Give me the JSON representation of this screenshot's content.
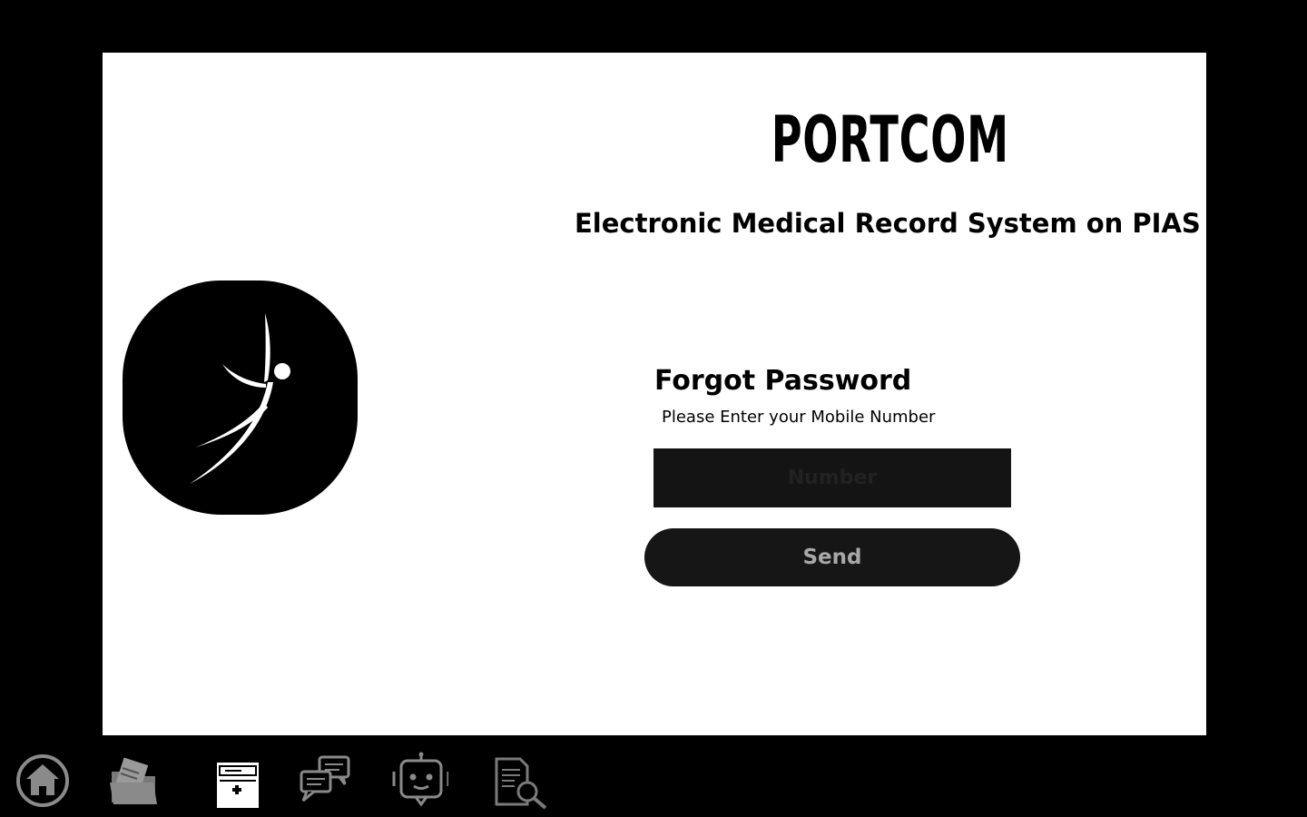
{
  "app": {
    "brand": "PORTCOM",
    "subtitle": "Electronic Medical Record System on PIAS"
  },
  "form": {
    "title": "Forgot Password",
    "hint": "Please Enter your Mobile Number",
    "number_placeholder": "Number",
    "number_value": "",
    "send_label": "Send"
  },
  "dock": {
    "items": [
      {
        "icon": "home-icon",
        "active": false
      },
      {
        "icon": "folder-icon",
        "active": false
      },
      {
        "icon": "medical-record-icon",
        "active": true
      },
      {
        "icon": "chat-icon",
        "active": false
      },
      {
        "icon": "robot-icon",
        "active": false
      },
      {
        "icon": "document-search-icon",
        "active": false
      }
    ]
  },
  "colors": {
    "background": "#000000",
    "panel": "#ffffff",
    "input_bg": "#141414",
    "button_bg": "#161616",
    "button_text": "#a8a8a8",
    "dock_icon": "#8a8a8a",
    "dock_icon_active": "#ffffff"
  }
}
